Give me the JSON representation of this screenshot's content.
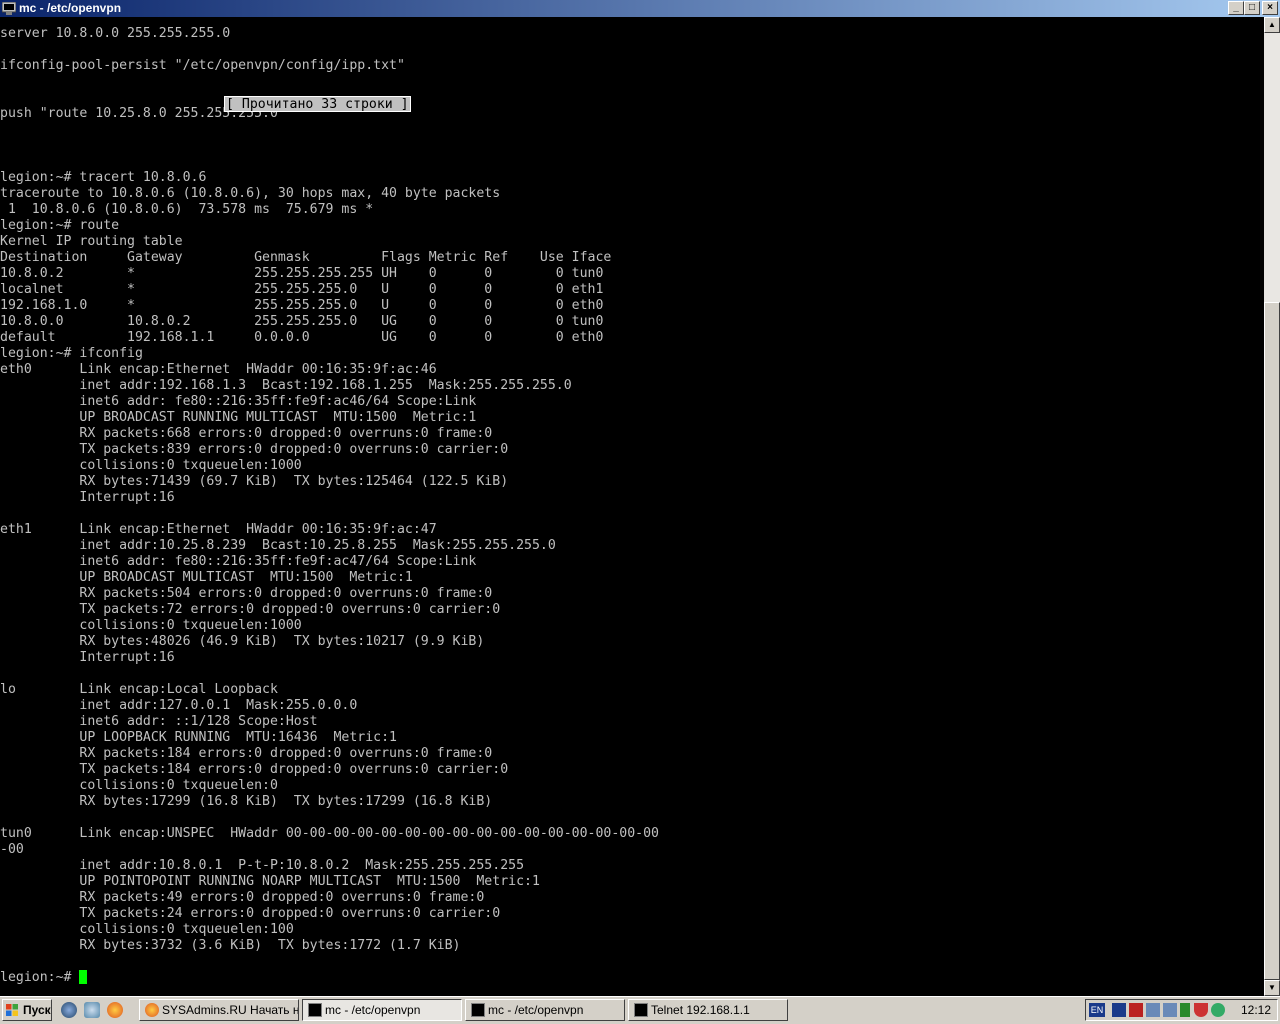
{
  "window": {
    "title": "mc - /etc/openvpn",
    "minimize_label": "_",
    "maximize_label": "□",
    "close_label": "×"
  },
  "terminal": {
    "lines": [
      "server 10.8.0.0 255.255.255.0",
      "",
      "ifconfig-pool-persist \"/etc/openvpn/config/ipp.txt\"",
      "",
      "",
      "push \"route 10.25.8.0 255.255.255.0\"",
      "",
      "",
      "",
      "legion:~# tracert 10.8.0.6",
      "traceroute to 10.8.0.6 (10.8.0.6), 30 hops max, 40 byte packets",
      " 1  10.8.0.6 (10.8.0.6)  73.578 ms  75.679 ms *",
      "legion:~# route",
      "Kernel IP routing table",
      "Destination     Gateway         Genmask         Flags Metric Ref    Use Iface",
      "10.8.0.2        *               255.255.255.255 UH    0      0        0 tun0",
      "localnet        *               255.255.255.0   U     0      0        0 eth1",
      "192.168.1.0     *               255.255.255.0   U     0      0        0 eth0",
      "10.8.0.0        10.8.0.2        255.255.255.0   UG    0      0        0 tun0",
      "default         192.168.1.1     0.0.0.0         UG    0      0        0 eth0",
      "legion:~# ifconfig",
      "eth0      Link encap:Ethernet  HWaddr 00:16:35:9f:ac:46",
      "          inet addr:192.168.1.3  Bcast:192.168.1.255  Mask:255.255.255.0",
      "          inet6 addr: fe80::216:35ff:fe9f:ac46/64 Scope:Link",
      "          UP BROADCAST RUNNING MULTICAST  MTU:1500  Metric:1",
      "          RX packets:668 errors:0 dropped:0 overruns:0 frame:0",
      "          TX packets:839 errors:0 dropped:0 overruns:0 carrier:0",
      "          collisions:0 txqueuelen:1000",
      "          RX bytes:71439 (69.7 KiB)  TX bytes:125464 (122.5 KiB)",
      "          Interrupt:16",
      "",
      "eth1      Link encap:Ethernet  HWaddr 00:16:35:9f:ac:47",
      "          inet addr:10.25.8.239  Bcast:10.25.8.255  Mask:255.255.255.0",
      "          inet6 addr: fe80::216:35ff:fe9f:ac47/64 Scope:Link",
      "          UP BROADCAST MULTICAST  MTU:1500  Metric:1",
      "          RX packets:504 errors:0 dropped:0 overruns:0 frame:0",
      "          TX packets:72 errors:0 dropped:0 overruns:0 carrier:0",
      "          collisions:0 txqueuelen:1000",
      "          RX bytes:48026 (46.9 KiB)  TX bytes:10217 (9.9 KiB)",
      "          Interrupt:16",
      "",
      "lo        Link encap:Local Loopback",
      "          inet addr:127.0.0.1  Mask:255.0.0.0",
      "          inet6 addr: ::1/128 Scope:Host",
      "          UP LOOPBACK RUNNING  MTU:16436  Metric:1",
      "          RX packets:184 errors:0 dropped:0 overruns:0 frame:0",
      "          TX packets:184 errors:0 dropped:0 overruns:0 carrier:0",
      "          collisions:0 txqueuelen:0",
      "          RX bytes:17299 (16.8 KiB)  TX bytes:17299 (16.8 KiB)",
      "",
      "tun0      Link encap:UNSPEC  HWaddr 00-00-00-00-00-00-00-00-00-00-00-00-00-00-00-00",
      "-00",
      "          inet addr:10.8.0.1  P-t-P:10.8.0.2  Mask:255.255.255.255",
      "          UP POINTOPOINT RUNNING NOARP MULTICAST  MTU:1500  Metric:1",
      "          RX packets:49 errors:0 dropped:0 overruns:0 frame:0",
      "          TX packets:24 errors:0 dropped:0 overruns:0 carrier:0",
      "          collisions:0 txqueuelen:100",
      "          RX bytes:3732 (3.6 KiB)  TX bytes:1772 (1.7 KiB)",
      ""
    ],
    "prompt": "legion:~# ",
    "status_message": "[ Прочитано 33 строки ]",
    "text_color": "#c0c0c0",
    "cursor_color": "#00ff00"
  },
  "taskbar": {
    "start_label": "Пуск",
    "tasks": [
      {
        "label": "SYSAdmins.RU Начать н...",
        "icon": "firefox-icon",
        "active": false
      },
      {
        "label": "mc - /etc/openvpn",
        "icon": "terminal-icon",
        "active": true
      },
      {
        "label": "mc - /etc/openvpn",
        "icon": "terminal-icon",
        "active": false
      },
      {
        "label": "Telnet 192.168.1.1",
        "icon": "terminal-icon",
        "active": false
      }
    ],
    "language": "EN",
    "clock": "12:12"
  }
}
